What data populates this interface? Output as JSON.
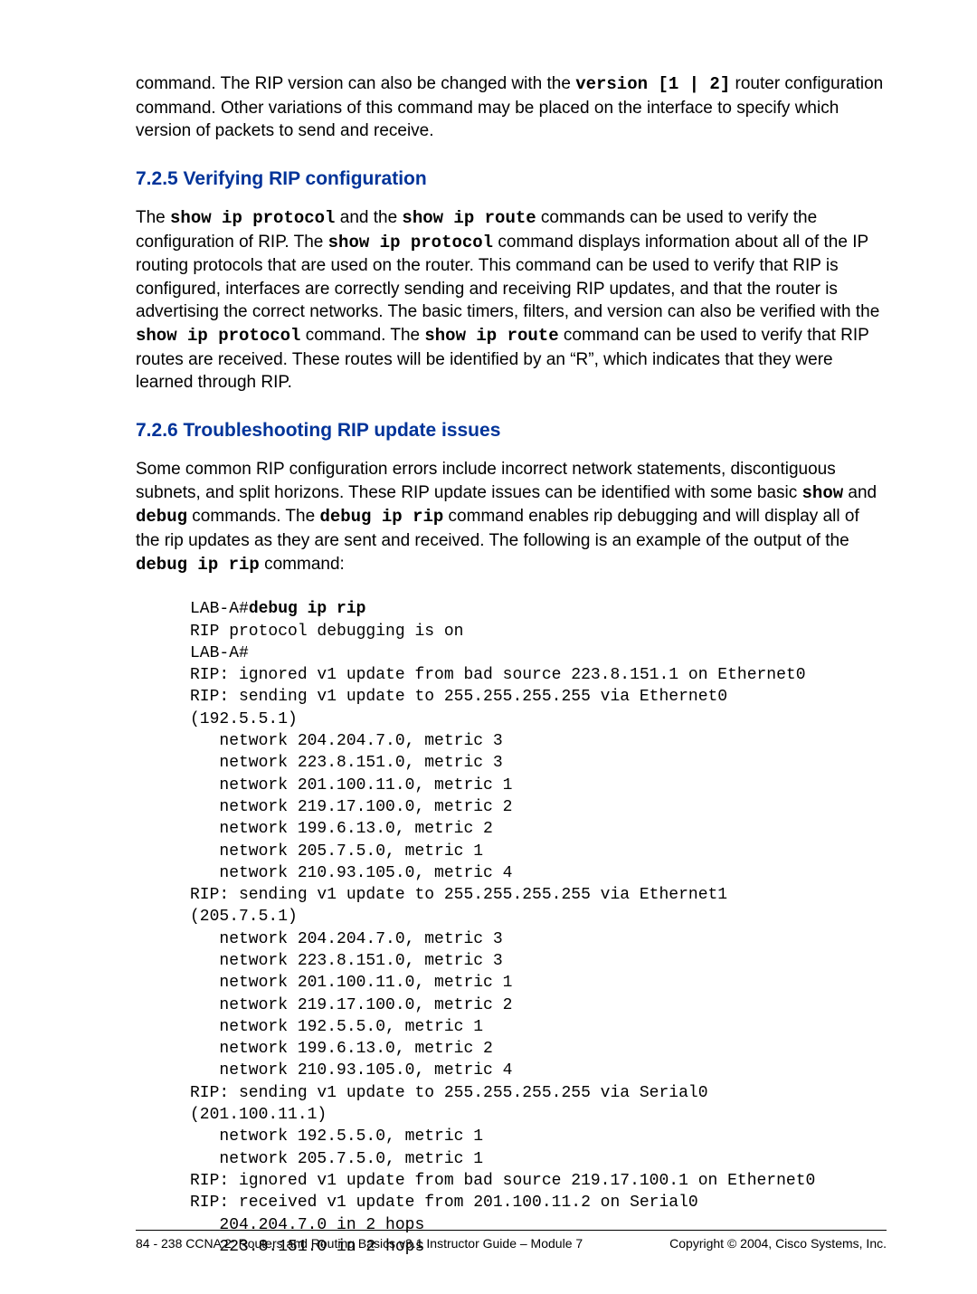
{
  "para_intro": {
    "p1": "command. The RIP version can also be changed with the ",
    "cmd": "version [1 | 2]",
    "p2": " router configuration command. Other variations of this command may be placed on the interface to specify which version of packets to send and receive."
  },
  "section725": {
    "heading": "7.2.5 Verifying RIP configuration",
    "t1": "The ",
    "c1": "show ip protocol",
    "t2": " and the ",
    "c2": "show ip route",
    "t3": " commands can be used to verify the configuration of RIP. The ",
    "c3": "show ip protocol",
    "t4": " command displays information about all of the IP routing protocols that are used on the router. This command can be used to verify that RIP is configured, interfaces are correctly sending and receiving RIP updates, and that the router is advertising the correct networks. The basic timers, filters, and version can also be verified with the ",
    "c4": "show ip protocol",
    "t5": " command. The ",
    "c5": "show ip route",
    "t6": " command can be used to verify that RIP routes are received. These routes will be identified by an “R”, which indicates that they were learned through RIP."
  },
  "section726": {
    "heading": "7.2.6 Troubleshooting RIP update issues",
    "t1": "Some common RIP configuration errors include incorrect network statements, discontiguous subnets, and split horizons. These RIP update issues can be identified with some basic ",
    "c1": "show",
    "t2": " and ",
    "c2": "debug",
    "t3": " commands. The ",
    "c3": "debug ip rip",
    "t4": " command enables rip debugging and will display all of the rip updates as they are sent and received. The following is an example of the output of the ",
    "c4": "debug ip rip",
    "t5": " command:"
  },
  "code": {
    "l01a": "LAB-A#",
    "l01b": "debug ip rip",
    "l02": "RIP protocol debugging is on",
    "l03": "LAB-A#",
    "l04": "RIP: ignored v1 update from bad source 223.8.151.1 on Ethernet0",
    "l05": "RIP: sending v1 update to 255.255.255.255 via Ethernet0",
    "l06": "(192.5.5.1)",
    "l07": "   network 204.204.7.0, metric 3",
    "l08": "   network 223.8.151.0, metric 3",
    "l09": "   network 201.100.11.0, metric 1",
    "l10": "   network 219.17.100.0, metric 2",
    "l11": "   network 199.6.13.0, metric 2",
    "l12": "   network 205.7.5.0, metric 1",
    "l13": "   network 210.93.105.0, metric 4",
    "l14": "RIP: sending v1 update to 255.255.255.255 via Ethernet1",
    "l15": "(205.7.5.1)",
    "l16": "   network 204.204.7.0, metric 3",
    "l17": "   network 223.8.151.0, metric 3",
    "l18": "   network 201.100.11.0, metric 1",
    "l19": "   network 219.17.100.0, metric 2",
    "l20": "   network 192.5.5.0, metric 1",
    "l21": "   network 199.6.13.0, metric 2",
    "l22": "   network 210.93.105.0, metric 4",
    "l23": "RIP: sending v1 update to 255.255.255.255 via Serial0",
    "l24": "(201.100.11.1)",
    "l25": "   network 192.5.5.0, metric 1",
    "l26": "   network 205.7.5.0, metric 1",
    "l27": "RIP: ignored v1 update from bad source 219.17.100.1 on Ethernet0",
    "l28": "RIP: received v1 update from 201.100.11.2 on Serial0",
    "l29": "   204.204.7.0 in 2 hops",
    "l30": "   223.8.151.0 in 2 hops"
  },
  "footer": {
    "left": "84 - 238    CCNA 2: Routers and Routing Basics v3.1 Instructor Guide – Module 7",
    "right": "Copyright © 2004, Cisco Systems, Inc."
  }
}
